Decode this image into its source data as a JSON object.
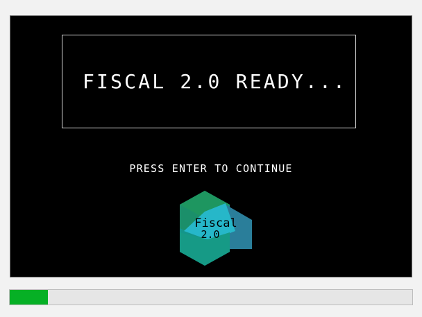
{
  "screen": {
    "title": "FISCAL 2.0 READY...",
    "prompt": "PRESS ENTER TO CONTINUE"
  },
  "logo": {
    "icon": "fiscal-hexagon-logo",
    "line1": "Fiscal",
    "line2": "2.0",
    "colors": {
      "top_left": "#1e9660",
      "top_right": "#2a7e9a",
      "center": "#26b7c9",
      "bottom": "#14958a",
      "text": "#000000"
    }
  },
  "progress": {
    "fraction": 0.095,
    "color": "#06b025",
    "track_color": "#e6e6e6"
  }
}
